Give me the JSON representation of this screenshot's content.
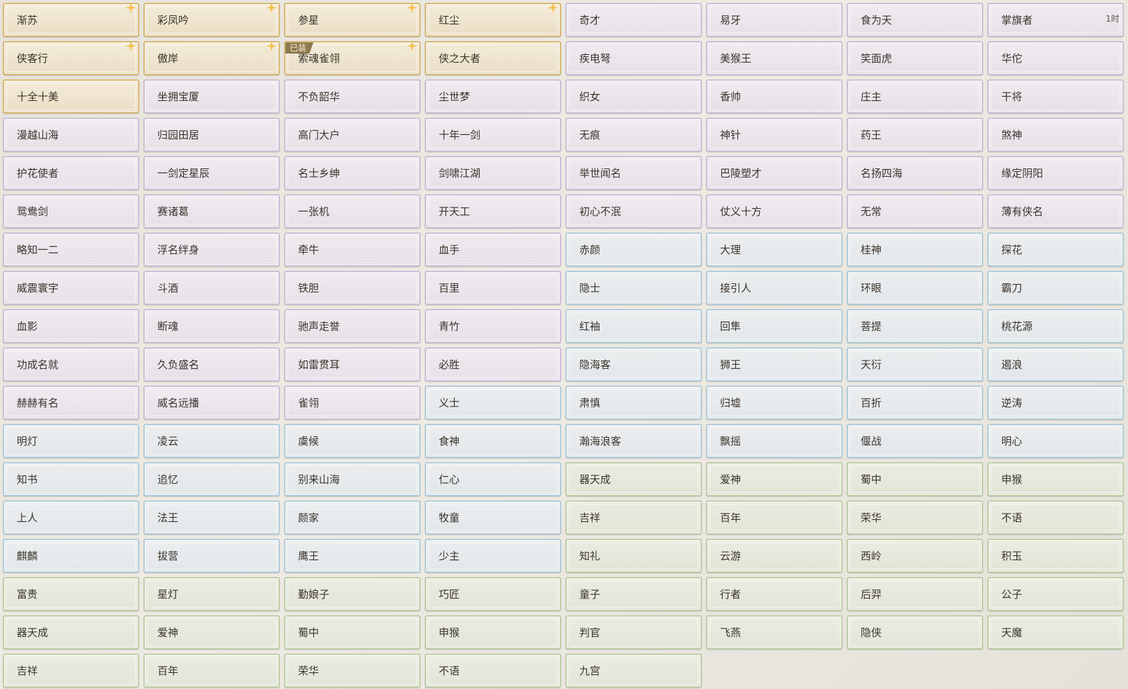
{
  "window": {
    "timer_text": "1时"
  },
  "equipped_badge": "已装",
  "colors": {
    "gold": "#d7b874",
    "purple": "#cdbfd8",
    "blue": "#b3cddb",
    "green": "#bfcfa9",
    "star": "#f2c14e"
  },
  "titles": [
    {
      "label": "渐苏",
      "rarity": "gold",
      "star": true
    },
    {
      "label": "彩凤吟",
      "rarity": "gold",
      "star": true
    },
    {
      "label": "参星",
      "rarity": "gold",
      "star": true
    },
    {
      "label": "红尘",
      "rarity": "gold",
      "star": true
    },
    {
      "label": "奇才",
      "rarity": "purple"
    },
    {
      "label": "易牙",
      "rarity": "purple"
    },
    {
      "label": "食为天",
      "rarity": "purple"
    },
    {
      "label": "掌旗者",
      "rarity": "purple"
    },
    {
      "label": "侠客行",
      "rarity": "gold",
      "star": true
    },
    {
      "label": "傲岸",
      "rarity": "gold",
      "star": true
    },
    {
      "label": "索魂雀翎",
      "rarity": "gold",
      "star": true,
      "equipped": true
    },
    {
      "label": "侠之大者",
      "rarity": "gold"
    },
    {
      "label": "疾电弩",
      "rarity": "purple"
    },
    {
      "label": "美猴王",
      "rarity": "purple"
    },
    {
      "label": "笑面虎",
      "rarity": "purple"
    },
    {
      "label": "华佗",
      "rarity": "purple"
    },
    {
      "label": "十全十美",
      "rarity": "gold"
    },
    {
      "label": "坐拥宝厦",
      "rarity": "purple"
    },
    {
      "label": "不负韶华",
      "rarity": "purple"
    },
    {
      "label": "尘世梦",
      "rarity": "purple"
    },
    {
      "label": "织女",
      "rarity": "purple"
    },
    {
      "label": "香帅",
      "rarity": "purple"
    },
    {
      "label": "庄主",
      "rarity": "purple"
    },
    {
      "label": "干将",
      "rarity": "purple"
    },
    {
      "label": "漫越山海",
      "rarity": "purple"
    },
    {
      "label": "归园田居",
      "rarity": "purple"
    },
    {
      "label": "高门大户",
      "rarity": "purple"
    },
    {
      "label": "十年一剑",
      "rarity": "purple"
    },
    {
      "label": "无痕",
      "rarity": "purple"
    },
    {
      "label": "神针",
      "rarity": "purple"
    },
    {
      "label": "药王",
      "rarity": "purple"
    },
    {
      "label": "煞神",
      "rarity": "purple"
    },
    {
      "label": "护花使者",
      "rarity": "purple"
    },
    {
      "label": "一剑定星辰",
      "rarity": "purple"
    },
    {
      "label": "名士乡绅",
      "rarity": "purple"
    },
    {
      "label": "剑啸江湖",
      "rarity": "purple"
    },
    {
      "label": "举世闻名",
      "rarity": "purple"
    },
    {
      "label": "巴陵塑才",
      "rarity": "purple"
    },
    {
      "label": "名扬四海",
      "rarity": "purple"
    },
    {
      "label": "缘定阴阳",
      "rarity": "purple"
    },
    {
      "label": "鸳鸯剑",
      "rarity": "purple"
    },
    {
      "label": "赛诸葛",
      "rarity": "purple"
    },
    {
      "label": "一张机",
      "rarity": "purple"
    },
    {
      "label": "开天工",
      "rarity": "purple"
    },
    {
      "label": "初心不泯",
      "rarity": "purple"
    },
    {
      "label": "仗义十方",
      "rarity": "purple"
    },
    {
      "label": "无常",
      "rarity": "purple"
    },
    {
      "label": "薄有侠名",
      "rarity": "purple"
    },
    {
      "label": "略知一二",
      "rarity": "purple"
    },
    {
      "label": "浮名绊身",
      "rarity": "purple"
    },
    {
      "label": "牵牛",
      "rarity": "purple"
    },
    {
      "label": "血手",
      "rarity": "purple"
    },
    {
      "label": "赤颜",
      "rarity": "blue"
    },
    {
      "label": "大理",
      "rarity": "blue"
    },
    {
      "label": "桂神",
      "rarity": "blue"
    },
    {
      "label": "探花",
      "rarity": "blue"
    },
    {
      "label": "威震寰宇",
      "rarity": "purple"
    },
    {
      "label": "斗酒",
      "rarity": "purple"
    },
    {
      "label": "铁胆",
      "rarity": "purple"
    },
    {
      "label": "百里",
      "rarity": "purple"
    },
    {
      "label": "隐士",
      "rarity": "blue"
    },
    {
      "label": "接引人",
      "rarity": "blue"
    },
    {
      "label": "环眼",
      "rarity": "blue"
    },
    {
      "label": "霸刀",
      "rarity": "blue"
    },
    {
      "label": "血影",
      "rarity": "purple"
    },
    {
      "label": "断魂",
      "rarity": "purple"
    },
    {
      "label": "驰声走誉",
      "rarity": "purple"
    },
    {
      "label": "青竹",
      "rarity": "purple"
    },
    {
      "label": "红袖",
      "rarity": "blue"
    },
    {
      "label": "回隼",
      "rarity": "blue"
    },
    {
      "label": "菩提",
      "rarity": "blue"
    },
    {
      "label": "桃花源",
      "rarity": "blue"
    },
    {
      "label": "功成名就",
      "rarity": "purple"
    },
    {
      "label": "久负盛名",
      "rarity": "purple"
    },
    {
      "label": "如雷贯耳",
      "rarity": "purple"
    },
    {
      "label": "必胜",
      "rarity": "purple"
    },
    {
      "label": "隐海客",
      "rarity": "blue"
    },
    {
      "label": "狮王",
      "rarity": "blue"
    },
    {
      "label": "天衍",
      "rarity": "blue"
    },
    {
      "label": "遏浪",
      "rarity": "blue"
    },
    {
      "label": "赫赫有名",
      "rarity": "purple"
    },
    {
      "label": "威名远播",
      "rarity": "purple"
    },
    {
      "label": "雀翎",
      "rarity": "purple"
    },
    {
      "label": "义士",
      "rarity": "blue"
    },
    {
      "label": "肃慎",
      "rarity": "blue"
    },
    {
      "label": "归墟",
      "rarity": "blue"
    },
    {
      "label": "百折",
      "rarity": "blue"
    },
    {
      "label": "逆涛",
      "rarity": "blue"
    },
    {
      "label": "明灯",
      "rarity": "blue"
    },
    {
      "label": "凌云",
      "rarity": "blue"
    },
    {
      "label": "虞候",
      "rarity": "blue"
    },
    {
      "label": "食神",
      "rarity": "blue"
    },
    {
      "label": "瀚海浪客",
      "rarity": "blue"
    },
    {
      "label": "飘摇",
      "rarity": "blue"
    },
    {
      "label": "偃战",
      "rarity": "blue"
    },
    {
      "label": "明心",
      "rarity": "blue"
    },
    {
      "label": "知书",
      "rarity": "blue"
    },
    {
      "label": "追忆",
      "rarity": "blue"
    },
    {
      "label": "别来山海",
      "rarity": "blue"
    },
    {
      "label": "仁心",
      "rarity": "blue"
    },
    {
      "label": "器天成",
      "rarity": "green"
    },
    {
      "label": "爱神",
      "rarity": "green"
    },
    {
      "label": "蜀中",
      "rarity": "green"
    },
    {
      "label": "申猴",
      "rarity": "green"
    },
    {
      "label": "上人",
      "rarity": "blue"
    },
    {
      "label": "法王",
      "rarity": "blue"
    },
    {
      "label": "颜家",
      "rarity": "blue"
    },
    {
      "label": "牧童",
      "rarity": "blue"
    },
    {
      "label": "吉祥",
      "rarity": "green"
    },
    {
      "label": "百年",
      "rarity": "green"
    },
    {
      "label": "荣华",
      "rarity": "green"
    },
    {
      "label": "不语",
      "rarity": "green"
    },
    {
      "label": "麒麟",
      "rarity": "blue"
    },
    {
      "label": "拔营",
      "rarity": "blue"
    },
    {
      "label": "鹰王",
      "rarity": "blue"
    },
    {
      "label": "少主",
      "rarity": "blue"
    },
    {
      "label": "知礼",
      "rarity": "green"
    },
    {
      "label": "云游",
      "rarity": "green"
    },
    {
      "label": "西岭",
      "rarity": "green"
    },
    {
      "label": "积玉",
      "rarity": "green"
    },
    {
      "label": "富贵",
      "rarity": "green"
    },
    {
      "label": "星灯",
      "rarity": "green"
    },
    {
      "label": "勤娘子",
      "rarity": "green"
    },
    {
      "label": "巧匠",
      "rarity": "green"
    },
    {
      "label": "童子",
      "rarity": "green"
    },
    {
      "label": "行者",
      "rarity": "green"
    },
    {
      "label": "后羿",
      "rarity": "green"
    },
    {
      "label": "公子",
      "rarity": "green"
    },
    {
      "label": "器天成",
      "rarity": "green"
    },
    {
      "label": "爱神",
      "rarity": "green"
    },
    {
      "label": "蜀中",
      "rarity": "green"
    },
    {
      "label": "申猴",
      "rarity": "green"
    },
    {
      "label": "判官",
      "rarity": "green"
    },
    {
      "label": "飞燕",
      "rarity": "green"
    },
    {
      "label": "隐侠",
      "rarity": "green"
    },
    {
      "label": "天魔",
      "rarity": "green"
    },
    {
      "label": "吉祥",
      "rarity": "green"
    },
    {
      "label": "百年",
      "rarity": "green"
    },
    {
      "label": "荣华",
      "rarity": "green"
    },
    {
      "label": "不语",
      "rarity": "green"
    },
    {
      "label": "九宫",
      "rarity": "green"
    }
  ]
}
